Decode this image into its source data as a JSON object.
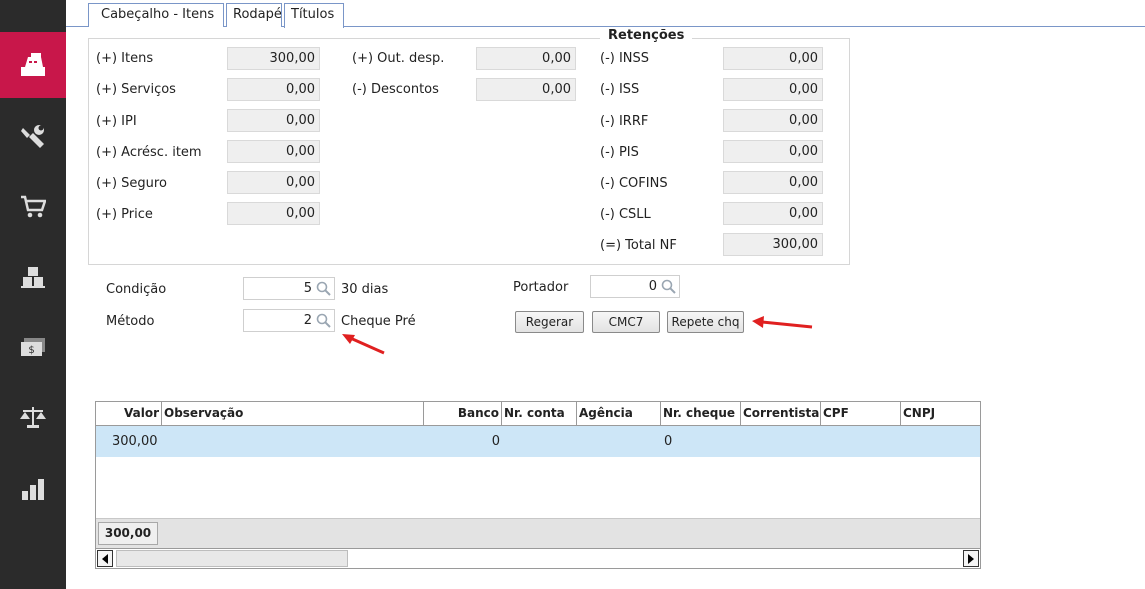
{
  "tabs": [
    {
      "label": "Cabeçalho - Itens"
    },
    {
      "label": "Rodapé"
    },
    {
      "label": "Títulos"
    }
  ],
  "sidebar": {
    "items": [
      {
        "icon": "cash-register-icon",
        "active": true
      },
      {
        "icon": "tools-icon",
        "active": false
      },
      {
        "icon": "cart-icon",
        "active": false
      },
      {
        "icon": "warehouse-icon",
        "active": false
      },
      {
        "icon": "money-icon",
        "active": false
      },
      {
        "icon": "scale-icon",
        "active": false
      },
      {
        "icon": "bar-chart-icon",
        "active": false
      }
    ]
  },
  "totals": {
    "itens": {
      "label": "(+) Itens",
      "value": "300,00"
    },
    "servicos": {
      "label": "(+) Serviços",
      "value": "0,00"
    },
    "ipi": {
      "label": "(+) IPI",
      "value": "0,00"
    },
    "acresc_item": {
      "label": "(+) Acrésc. item",
      "value": "0,00"
    },
    "seguro": {
      "label": "(+) Seguro",
      "value": "0,00"
    },
    "price": {
      "label": "(+) Price",
      "value": "0,00"
    },
    "out_desp": {
      "label": "(+) Out. desp.",
      "value": "0,00"
    },
    "descontos": {
      "label": "(-) Descontos",
      "value": "0,00"
    }
  },
  "retencoes": {
    "title": "Retenções",
    "inss": {
      "label": "(-) INSS",
      "value": "0,00"
    },
    "iss": {
      "label": "(-) ISS",
      "value": "0,00"
    },
    "irrf": {
      "label": "(-) IRRF",
      "value": "0,00"
    },
    "pis": {
      "label": "(-) PIS",
      "value": "0,00"
    },
    "cofins": {
      "label": "(-) COFINS",
      "value": "0,00"
    },
    "csll": {
      "label": "(-) CSLL",
      "value": "0,00"
    },
    "total_nf": {
      "label": "(=) Total NF",
      "value": "300,00"
    }
  },
  "condicao": {
    "label": "Condição",
    "value": "5",
    "description": "30 dias"
  },
  "metodo": {
    "label": "Método",
    "value": "2",
    "description": "Cheque Pré"
  },
  "portador": {
    "label": "Portador",
    "value": "0"
  },
  "buttons": {
    "regerar": "Regerar",
    "cmc7": "CMC7",
    "repete_chq": "Repete chq"
  },
  "grid": {
    "columns": [
      "Valor",
      "Observação",
      "Banco",
      "Nr. conta",
      "Agência",
      "Nr. cheque",
      "Correntista",
      "CPF",
      "CNPJ"
    ],
    "rows": [
      {
        "valor": "300,00",
        "observacao": "",
        "banco": "0",
        "nr_conta": "",
        "agencia": "",
        "nr_cheque": "0",
        "correntista": "",
        "cpf": "",
        "cnpj": ""
      }
    ],
    "footer_total": "300,00"
  },
  "colors": {
    "sidebar_bg": "#2b2b2b",
    "sidebar_active": "#c8174a",
    "row_selected": "#cde6f7",
    "arrow": "#e02020"
  }
}
